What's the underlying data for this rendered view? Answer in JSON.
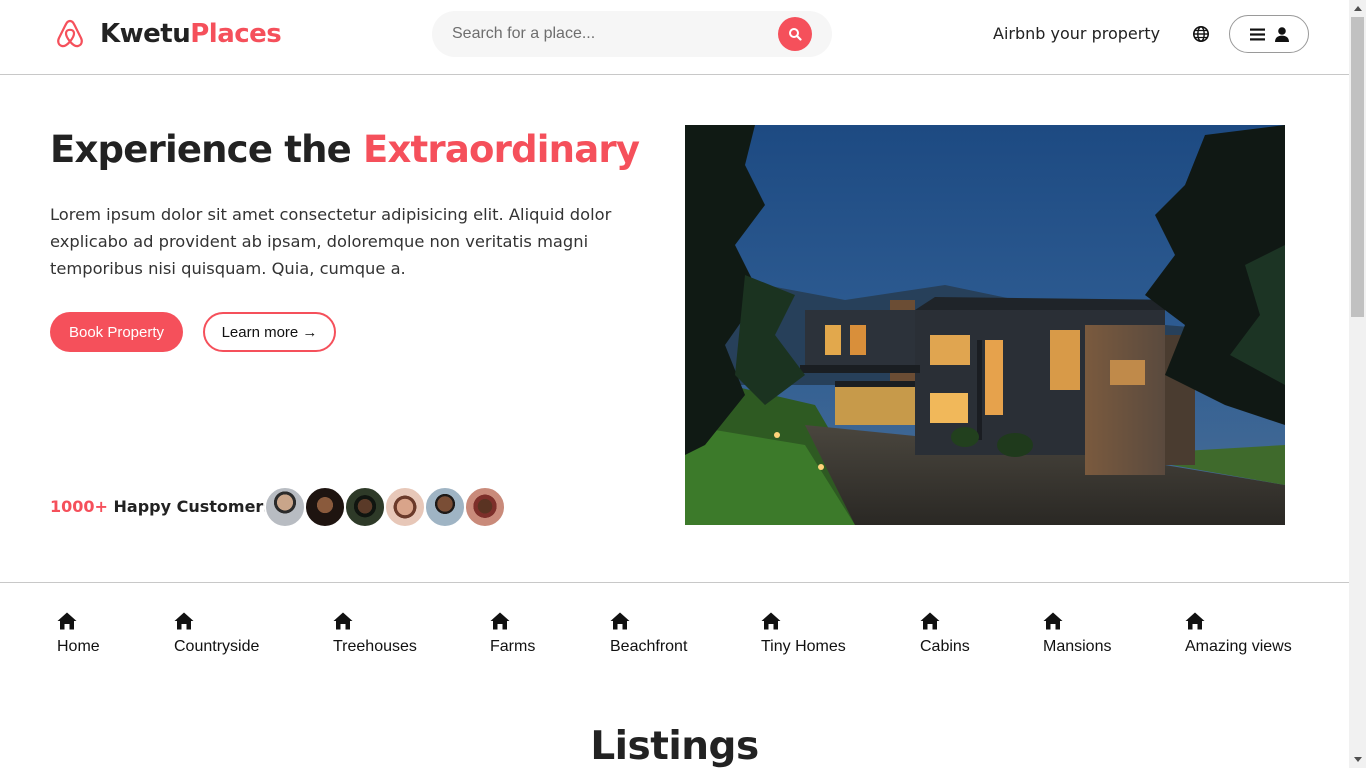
{
  "header": {
    "brand_primary": "Kwetu",
    "brand_accent": "Places",
    "search_placeholder": "Search for a place...",
    "host_link": "Airbnb your property",
    "icons": {
      "logo": "airbnb-logo-icon",
      "search": "search-icon",
      "globe": "globe-icon",
      "menu": "hamburger-icon",
      "user": "user-icon"
    }
  },
  "hero": {
    "title_primary": "Experience the ",
    "title_accent": "Extraordinary",
    "description": "Lorem ipsum dolor sit amet consectetur adipisicing elit. Aliquid dolor explicabo ad provident ab ipsam, doloremque non veritatis magni temporibus nisi quisquam. Quia, cumque a.",
    "book_button": "Book Property",
    "learn_button": "Learn more →",
    "customers_count": "1000+",
    "customers_label": " Happy Customers",
    "avatar_count": 6
  },
  "categories": [
    {
      "label": "Home",
      "icon": "home-icon"
    },
    {
      "label": "Countryside",
      "icon": "home-icon"
    },
    {
      "label": "Treehouses",
      "icon": "home-icon"
    },
    {
      "label": "Farms",
      "icon": "home-icon"
    },
    {
      "label": "Beachfront",
      "icon": "home-icon"
    },
    {
      "label": "Tiny Homes",
      "icon": "home-icon"
    },
    {
      "label": "Cabins",
      "icon": "home-icon"
    },
    {
      "label": "Mansions",
      "icon": "home-icon"
    },
    {
      "label": "Amazing views",
      "icon": "home-icon"
    }
  ],
  "listings": {
    "title": "Listings"
  },
  "colors": {
    "accent": "#f5505b",
    "text": "#222222",
    "divider": "#c8c8c8"
  }
}
